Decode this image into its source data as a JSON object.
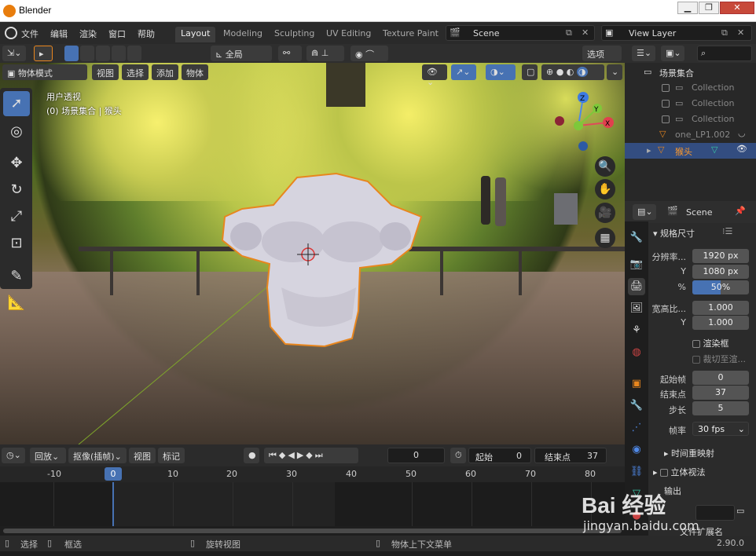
{
  "window": {
    "title": "Blender"
  },
  "menubar": {
    "items": [
      "文件",
      "编辑",
      "渲染",
      "窗口",
      "帮助"
    ],
    "workspaces": [
      "Layout",
      "Modeling",
      "Sculpting",
      "UV Editing",
      "Texture Paint"
    ],
    "active_workspace": "Layout",
    "scene": "Scene",
    "view_layer": "View Layer"
  },
  "viewport_header": {
    "transform_orientation": "全局",
    "options_label": "选项",
    "mode": "物体模式",
    "menus": [
      "视图",
      "选择",
      "添加",
      "物体"
    ]
  },
  "viewport": {
    "view_name": "用户透视",
    "context": "(0) 场景集合 | 猴头",
    "gizmo_axes": {
      "x": "X",
      "y": "Y",
      "z": "Z"
    }
  },
  "outliner": {
    "root": "场景集合",
    "items": [
      {
        "name": "Collection"
      },
      {
        "name": "Collection"
      },
      {
        "name": "Collection"
      },
      {
        "name": "one_LP1.002"
      },
      {
        "name": "猴头"
      }
    ]
  },
  "properties": {
    "scene_name": "Scene",
    "panel_format": "规格尺寸",
    "resolution_label": "分辨率...",
    "res_x": "1920 px",
    "y_label": "Y",
    "res_y": "1080 px",
    "percent_label": "%",
    "res_percent": "50%",
    "res_percent_value": 0.5,
    "aspect_label": "宽高比...",
    "aspect_x": "1.000",
    "aspect_y": "1.000",
    "render_region": "渲染框",
    "crop": "裁切至渲...",
    "frame_start_label": "起始帧",
    "frame_start": "0",
    "frame_end_label": "结束点",
    "frame_end": "37",
    "frame_step_label": "步长",
    "frame_step": "5",
    "fps_label": "帧率",
    "fps": "30 fps",
    "time_remap": "时间重映射",
    "stereoscopy": "立体视法",
    "output": "输出",
    "file_ext": "文件扩展名"
  },
  "timeline": {
    "playback": "回放",
    "keying": "抠像(插帧)",
    "view": "视图",
    "marker": "标记",
    "current_frame": "0",
    "start_label": "起始",
    "start": "0",
    "end_label": "结束点",
    "end": "37",
    "ticks": [
      "-10",
      "0",
      "10",
      "20",
      "30",
      "40",
      "50",
      "60",
      "70",
      "80"
    ]
  },
  "statusbar": {
    "select": "选择",
    "box_select": "框选",
    "rotate_view": "旋转视图",
    "context_menu": "物体上下文菜单",
    "version": "2.90.0"
  },
  "watermark": {
    "text": "Bai 经验",
    "url": "jingyan.baidu.com"
  },
  "colors": {
    "accent": "#4772b3",
    "selection_outline": "#e8861e",
    "header_bg": "#2b2b2b"
  }
}
